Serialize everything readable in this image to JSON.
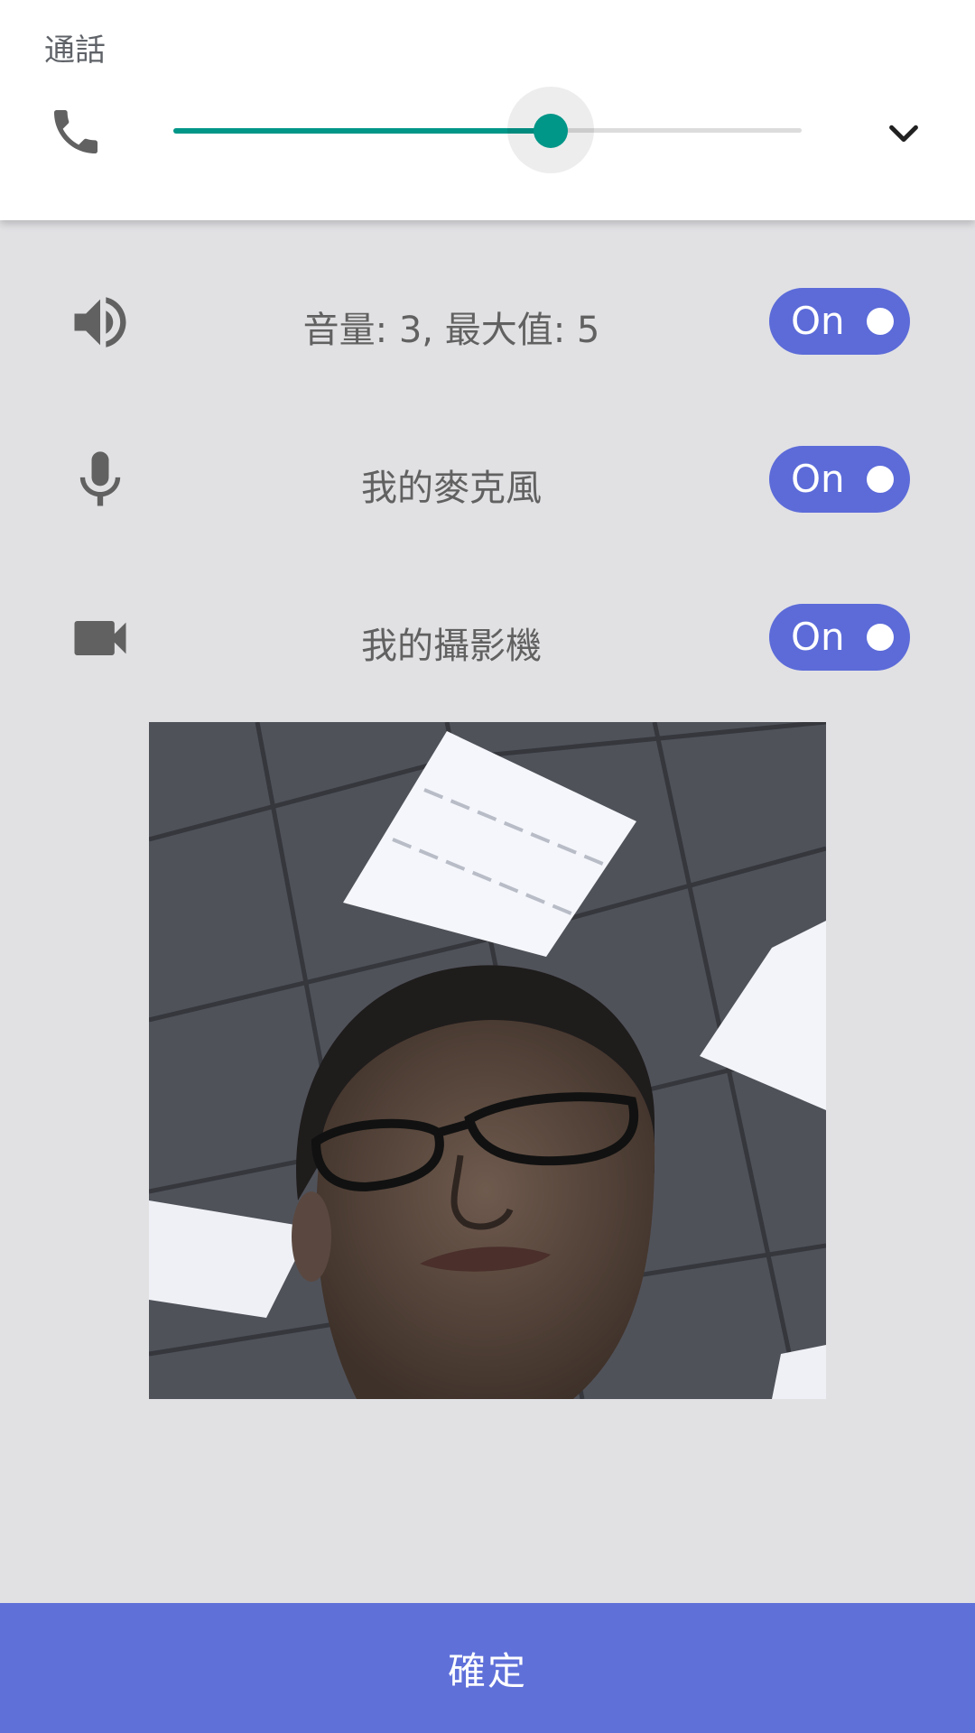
{
  "volume_panel": {
    "stream_label": "通話",
    "stream_icon": "phone-icon",
    "level_fraction": 0.6,
    "expand_icon": "chevron-down-icon",
    "accent_color": "#009688"
  },
  "devices": [
    {
      "icon": "speaker-icon",
      "label": "音量: 3, 最大值: 5",
      "toggle": "On"
    },
    {
      "icon": "microphone-icon",
      "label": "我的麥克風",
      "toggle": "On"
    },
    {
      "icon": "video-camera-icon",
      "label": "我的攝影機",
      "toggle": "On"
    }
  ],
  "preview": {
    "kind": "camera-preview"
  },
  "confirm_button": {
    "label": "確定"
  },
  "colors": {
    "toggle_bg": "#5c6bd8",
    "button_bg": "#5f70d9",
    "panel_bg": "#e1e1e4"
  }
}
